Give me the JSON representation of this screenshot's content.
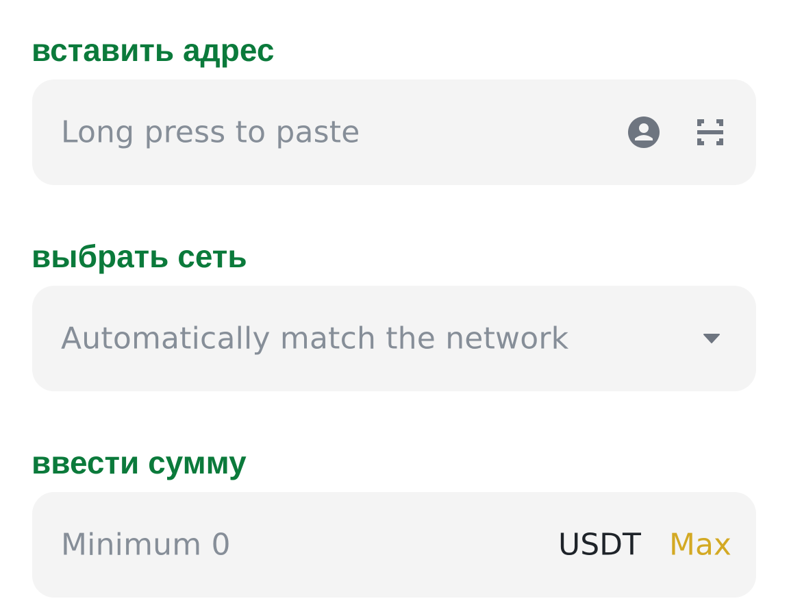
{
  "address": {
    "label": "вставить адрес",
    "placeholder": "Long press to paste",
    "icons": [
      "contact-icon",
      "scan-icon"
    ]
  },
  "network": {
    "label": "выбрать сеть",
    "value": "Automatically match the network",
    "icon": "caret-down-icon"
  },
  "amount": {
    "label": "ввести сумму",
    "placeholder": "Minimum 0",
    "unit": "USDT",
    "max_label": "Max"
  },
  "colors": {
    "label_green": "#0b7a3b",
    "field_bg": "#f4f4f4",
    "placeholder_gray": "#868e98",
    "max_yellow": "#d3a923",
    "unit_dark": "#1e2329"
  }
}
